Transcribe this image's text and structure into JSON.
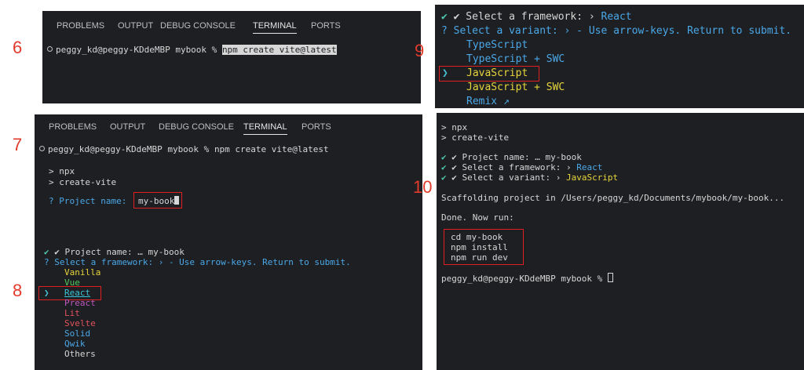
{
  "steps": {
    "s6": "6",
    "s7": "7",
    "s8": "8",
    "s9": "9",
    "s10": "10"
  },
  "tabs": [
    "PROBLEMS",
    "OUTPUT",
    "DEBUG CONSOLE",
    "TERMINAL",
    "PORTS"
  ],
  "prompt": "peggy_kd@peggy-KDdeMBP mybook %",
  "command": "npm create vite@latest",
  "npx_lines": [
    "> npx",
    "> create-vite"
  ],
  "project_name_label": "? Project name: ",
  "project_name_value": "my-book",
  "panel8": {
    "project_line": "✔ Project name: … my-book",
    "framework_prompt": "? Select a framework: › - Use arrow-keys. Return to submit.",
    "frameworks": [
      "Vanilla",
      "Vue",
      "React",
      "Preact",
      "Lit",
      "Svelte",
      "Solid",
      "Qwik",
      "Others"
    ],
    "selected": "React",
    "pointer": "❯"
  },
  "panel9": {
    "framework_line": "✔ Select a framework: › ",
    "framework_value": "React",
    "variant_prompt": "? Select a variant: › - Use arrow-keys. Return to submit.",
    "variants": [
      "TypeScript",
      "TypeScript + SWC",
      "JavaScript",
      "JavaScript + SWC",
      "Remix ↗"
    ],
    "selected": "JavaScript",
    "pointer": "❯"
  },
  "panel10": {
    "lines_top": [
      "> npx",
      "> create-vite"
    ],
    "project_line": "✔ Project name: … my-book",
    "framework_label": "✔ Select a framework: › ",
    "framework_value": "React",
    "variant_label": "✔ Select a variant: › ",
    "variant_value": "JavaScript",
    "scaffold": "Scaffolding project in /Users/peggy_kd/Documents/mybook/my-book...",
    "done": "Done. Now run:",
    "commands": [
      "cd my-book",
      "npm install",
      "npm run dev"
    ],
    "final_prompt": "peggy_kd@peggy-KDdeMBP mybook %"
  },
  "colors": {
    "accent_red": "#e02020",
    "terminal_bg": "#1e1f22"
  }
}
